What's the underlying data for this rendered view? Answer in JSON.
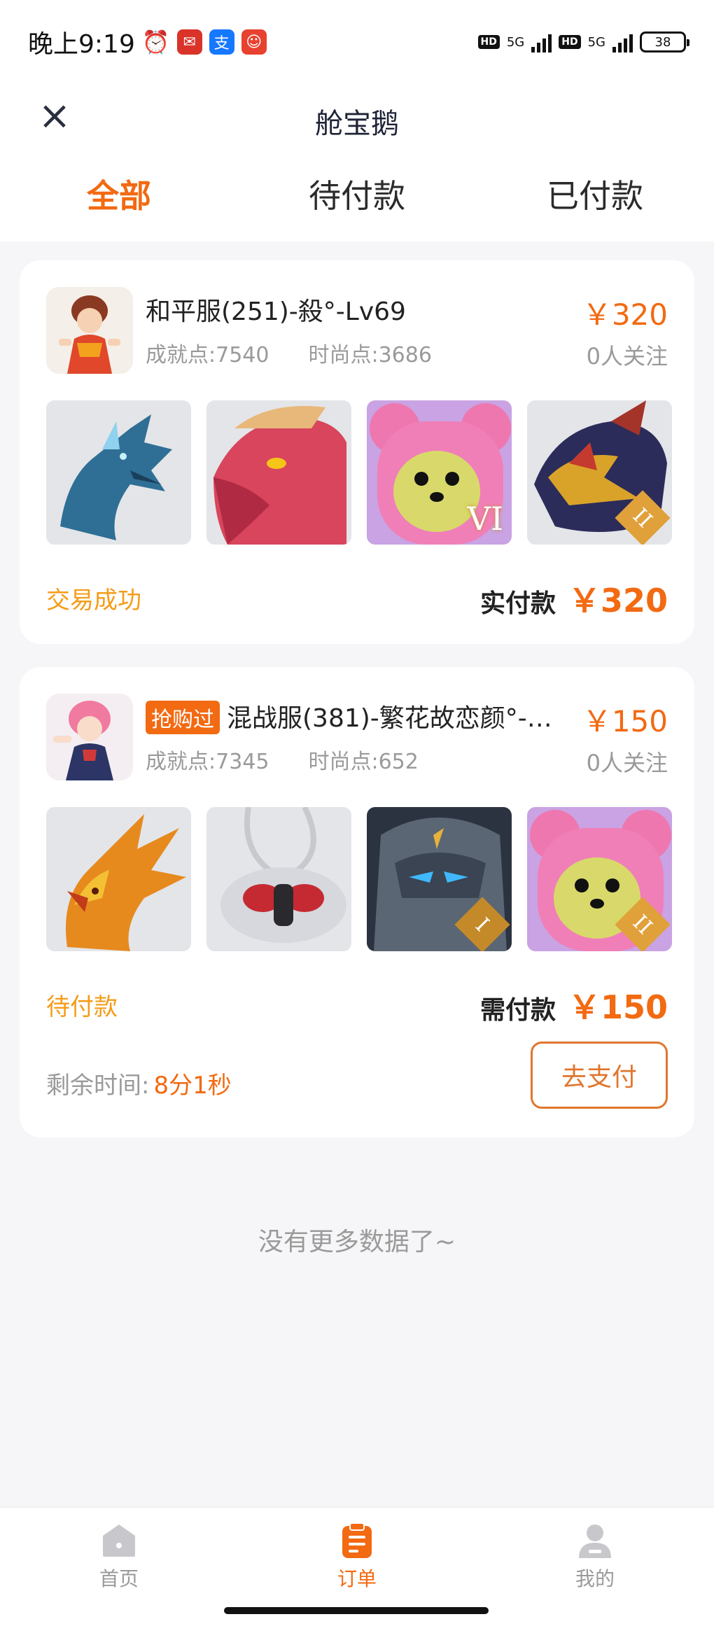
{
  "status_bar": {
    "time": "晚上9:19",
    "battery": "38",
    "hd_label": "HD",
    "network": "5G"
  },
  "header": {
    "title": "舱宝鹅",
    "close_icon": "close-icon"
  },
  "tabs": [
    {
      "label": "全部",
      "active": true
    },
    {
      "label": "待付款",
      "active": false
    },
    {
      "label": "已付款",
      "active": false
    }
  ],
  "orders": [
    {
      "name": "和平服(251)-殺°-Lv69",
      "badge": "",
      "achievement": "成就点:7540",
      "fashion": "时尚点:3686",
      "price": "￥320",
      "followers": "0人关注",
      "thumbs": [
        {
          "subject": "blue dragon"
        },
        {
          "subject": "red dragon"
        },
        {
          "subject": "pink bear",
          "tier": "VI"
        },
        {
          "subject": "dark dragon",
          "tier": "II"
        }
      ],
      "status": "交易成功",
      "amount_label": "实付款",
      "amount": "￥320"
    },
    {
      "name": "混战服(381)-繁花故恋颜°-…",
      "badge": "抢购过",
      "achievement": "成就点:7345",
      "fashion": "时尚点:652",
      "price": "￥150",
      "followers": "0人关注",
      "thumbs": [
        {
          "subject": "golden phoenix"
        },
        {
          "subject": "silver insect"
        },
        {
          "subject": "stone knight",
          "tier": "I"
        },
        {
          "subject": "pink bear",
          "tier": "II"
        }
      ],
      "status": "待付款",
      "amount_label": "需付款",
      "amount": "￥150",
      "countdown_label": "剩余时间:",
      "countdown_value": "8分1秒",
      "pay_button": "去支付"
    }
  ],
  "footer_text": "没有更多数据了~",
  "bottom_nav": [
    {
      "label": "首页",
      "icon": "home-icon",
      "active": false
    },
    {
      "label": "订单",
      "icon": "orders-icon",
      "active": true
    },
    {
      "label": "我的",
      "icon": "profile-icon",
      "active": false
    }
  ],
  "colors": {
    "accent": "#f26a12",
    "status_success": "#f59c18",
    "muted": "#9a9a9a"
  }
}
